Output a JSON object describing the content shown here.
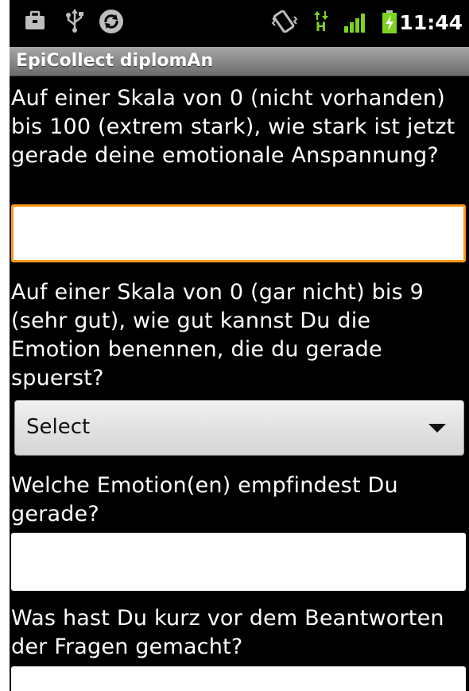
{
  "status_bar": {
    "time": "11:44",
    "icons": [
      "briefcase-icon",
      "usb-icon",
      "sync-icon",
      "vibrate-icon",
      "data-transfer-icon",
      "signal-icon",
      "battery-charging-icon"
    ],
    "data_indicator": "H"
  },
  "app": {
    "title": "EpiCollect diplomAn"
  },
  "questions": [
    {
      "text": "Auf einer Skala von 0 (nicht vorhanden) bis 100 (extrem stark), wie stark ist jetzt gerade deine emotionale Anspannung?",
      "input_type": "text",
      "value": ""
    },
    {
      "text": "Auf einer Skala von 0 (gar nicht) bis 9 (sehr gut), wie gut kannst Du die Emotion benennen, die du gerade spuerst?",
      "input_type": "select",
      "selected": "Select"
    },
    {
      "text": "Welche Emotion(en) empfindest Du gerade?",
      "input_type": "text",
      "value": ""
    },
    {
      "text": "Was hast Du kurz vor dem Beantworten der Fragen gemacht?",
      "input_type": "text",
      "value": ""
    }
  ],
  "colors": {
    "background": "#000000",
    "focus_border": "#ff9a1a",
    "signal": "#7ed321",
    "battery": "#7ed321"
  }
}
